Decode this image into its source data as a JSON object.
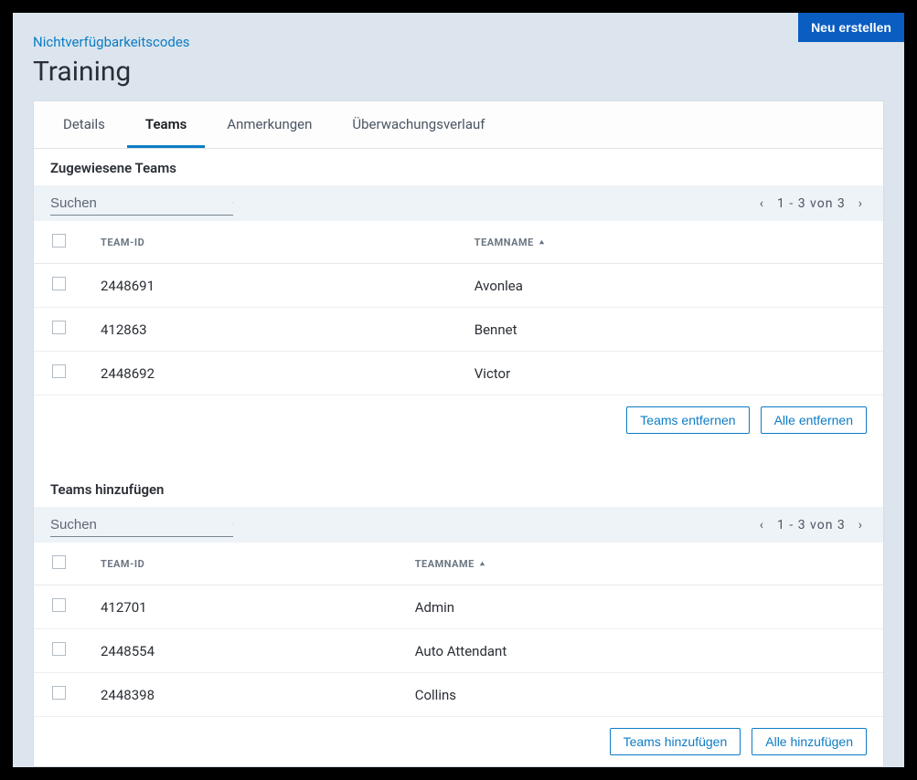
{
  "header": {
    "breadcrumb": "Nichtverfügbarkeitscodes",
    "title": "Training",
    "create_button": "Neu erstellen"
  },
  "tabs": [
    {
      "label": "Details",
      "active": false
    },
    {
      "label": "Teams",
      "active": true
    },
    {
      "label": "Anmerkungen",
      "active": false
    },
    {
      "label": "Überwachungsverlauf",
      "active": false
    }
  ],
  "assigned": {
    "title": "Zugewiesene Teams",
    "search_placeholder": "Suchen",
    "pager": "1 - 3 von 3",
    "columns": {
      "team_id": "TEAM-ID",
      "team_name": "TEAMNAME"
    },
    "rows": [
      {
        "id": "2448691",
        "name": "Avonlea"
      },
      {
        "id": "412863",
        "name": "Bennet"
      },
      {
        "id": "2448692",
        "name": "Victor"
      }
    ],
    "actions": {
      "remove": "Teams entfernen",
      "remove_all": "Alle entfernen"
    }
  },
  "add": {
    "title": "Teams hinzufügen",
    "search_placeholder": "Suchen",
    "pager": "1 - 3 von 3",
    "columns": {
      "team_id": "TEAM-ID",
      "team_name": "TEAMNAME"
    },
    "rows": [
      {
        "id": "412701",
        "name": "Admin"
      },
      {
        "id": "2448554",
        "name": "Auto Attendant"
      },
      {
        "id": "2448398",
        "name": "Collins"
      }
    ],
    "actions": {
      "add": "Teams hinzufügen",
      "add_all": "Alle hinzufügen"
    }
  }
}
